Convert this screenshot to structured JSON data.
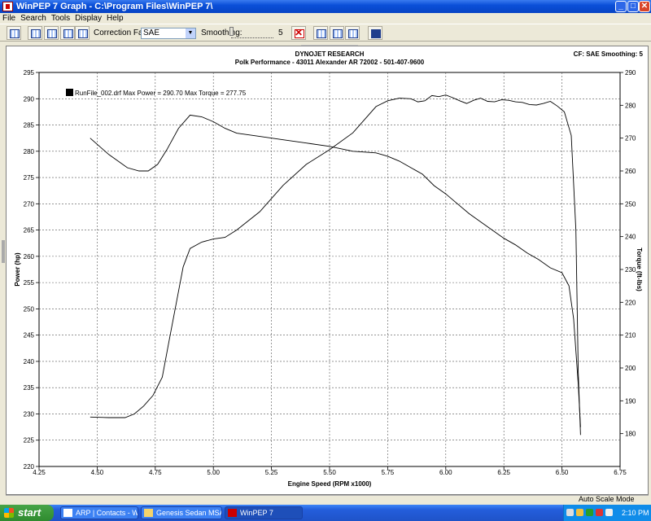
{
  "window": {
    "title": "WinPEP 7    Graph - C:\\Program Files\\WinPEP 7\\",
    "min_label": "_",
    "max_label": "□",
    "close_label": "✕"
  },
  "menu": [
    "File",
    "Search",
    "Tools",
    "Display",
    "Help"
  ],
  "toolbar": {
    "correction_label": "Correction Factor:",
    "correction_value": "SAE",
    "smoothing_label": "Smoothing:",
    "smoothing_value": "5"
  },
  "header": {
    "line1": "DYNOJET RESEARCH",
    "line2": "Polk Performance - 43011 Alexander AR 72002 - 501-407-9600",
    "settings": "CF: SAE  Smoothing: 5"
  },
  "chart_data": {
    "type": "line",
    "legend": "RunFile_002.drf Max Power = 290.70 Max Torque = 277.75",
    "xlabel": "Engine Speed (RPM x1000)",
    "ylabel_left": "Power (hp)",
    "ylabel_right": "Torque (ft-lbs)",
    "xlim": [
      4.25,
      6.75
    ],
    "ylim_left": [
      220,
      295
    ],
    "ylim_right": [
      170,
      290
    ],
    "x_ticks": [
      "4.25",
      "4.50",
      "4.75",
      "5.00",
      "5.25",
      "5.50",
      "5.75",
      "6.00",
      "6.25",
      "6.50",
      "6.75"
    ],
    "y_ticks_left": [
      "220",
      "225",
      "230",
      "235",
      "240",
      "245",
      "250",
      "255",
      "260",
      "265",
      "270",
      "275",
      "280",
      "285",
      "290",
      "295"
    ],
    "y_ticks_right": [
      "180",
      "190",
      "200",
      "210",
      "220",
      "230",
      "240",
      "250",
      "260",
      "270",
      "280",
      "290"
    ],
    "grid": true,
    "series": [
      {
        "name": "Power",
        "axis": "left",
        "x": [
          4.47,
          4.55,
          4.62,
          4.66,
          4.7,
          4.74,
          4.78,
          4.81,
          4.84,
          4.87,
          4.9,
          4.95,
          5.0,
          5.05,
          5.1,
          5.2,
          5.3,
          5.4,
          5.5,
          5.6,
          5.7,
          5.75,
          5.8,
          5.85,
          5.88,
          5.91,
          5.94,
          5.97,
          6.0,
          6.03,
          6.06,
          6.09,
          6.12,
          6.15,
          6.18,
          6.21,
          6.24,
          6.27,
          6.3,
          6.33,
          6.36,
          6.39,
          6.42,
          6.45,
          6.48,
          6.51,
          6.54,
          6.56,
          6.57,
          6.58
        ],
        "y": [
          229.4,
          229.3,
          229.3,
          230.0,
          231.5,
          233.5,
          237.0,
          244.0,
          251.0,
          258.0,
          261.5,
          262.7,
          263.3,
          263.6,
          265.0,
          268.5,
          273.5,
          277.5,
          280.3,
          283.5,
          288.5,
          289.6,
          290.1,
          290.0,
          289.4,
          289.6,
          290.6,
          290.4,
          290.7,
          290.2,
          289.6,
          289.1,
          289.7,
          290.1,
          289.5,
          289.4,
          289.8,
          289.7,
          289.4,
          289.3,
          288.9,
          288.8,
          289.1,
          289.5,
          288.6,
          287.5,
          283.0,
          265.0,
          238.0,
          226.0
        ]
      },
      {
        "name": "Torque",
        "axis": "right",
        "x": [
          4.47,
          4.55,
          4.63,
          4.68,
          4.72,
          4.76,
          4.8,
          4.85,
          4.9,
          4.95,
          5.0,
          5.05,
          5.1,
          5.2,
          5.3,
          5.4,
          5.5,
          5.6,
          5.7,
          5.75,
          5.8,
          5.85,
          5.9,
          5.95,
          6.0,
          6.05,
          6.1,
          6.15,
          6.2,
          6.25,
          6.3,
          6.35,
          6.4,
          6.45,
          6.5,
          6.53,
          6.55,
          6.57,
          6.58
        ],
        "y": [
          270.0,
          265.0,
          261.0,
          260.0,
          260.0,
          262.0,
          266.5,
          273.0,
          277.0,
          276.5,
          275.0,
          273.0,
          271.5,
          270.5,
          269.5,
          268.5,
          267.5,
          266.0,
          265.5,
          264.5,
          263.0,
          261.0,
          259.0,
          255.5,
          253.0,
          250.0,
          247.0,
          244.5,
          242.0,
          239.5,
          237.5,
          235.0,
          233.0,
          230.5,
          229.0,
          225.0,
          215.0,
          195.0,
          182.0
        ]
      }
    ]
  },
  "status": {
    "mode": "Auto Scale Mode"
  },
  "taskbar": {
    "start_label": "start",
    "tasks": [
      "ARP | Contacts - Win...",
      "Genesis Sedan MSA",
      "WinPEP 7"
    ],
    "clock": "2:10 PM"
  }
}
